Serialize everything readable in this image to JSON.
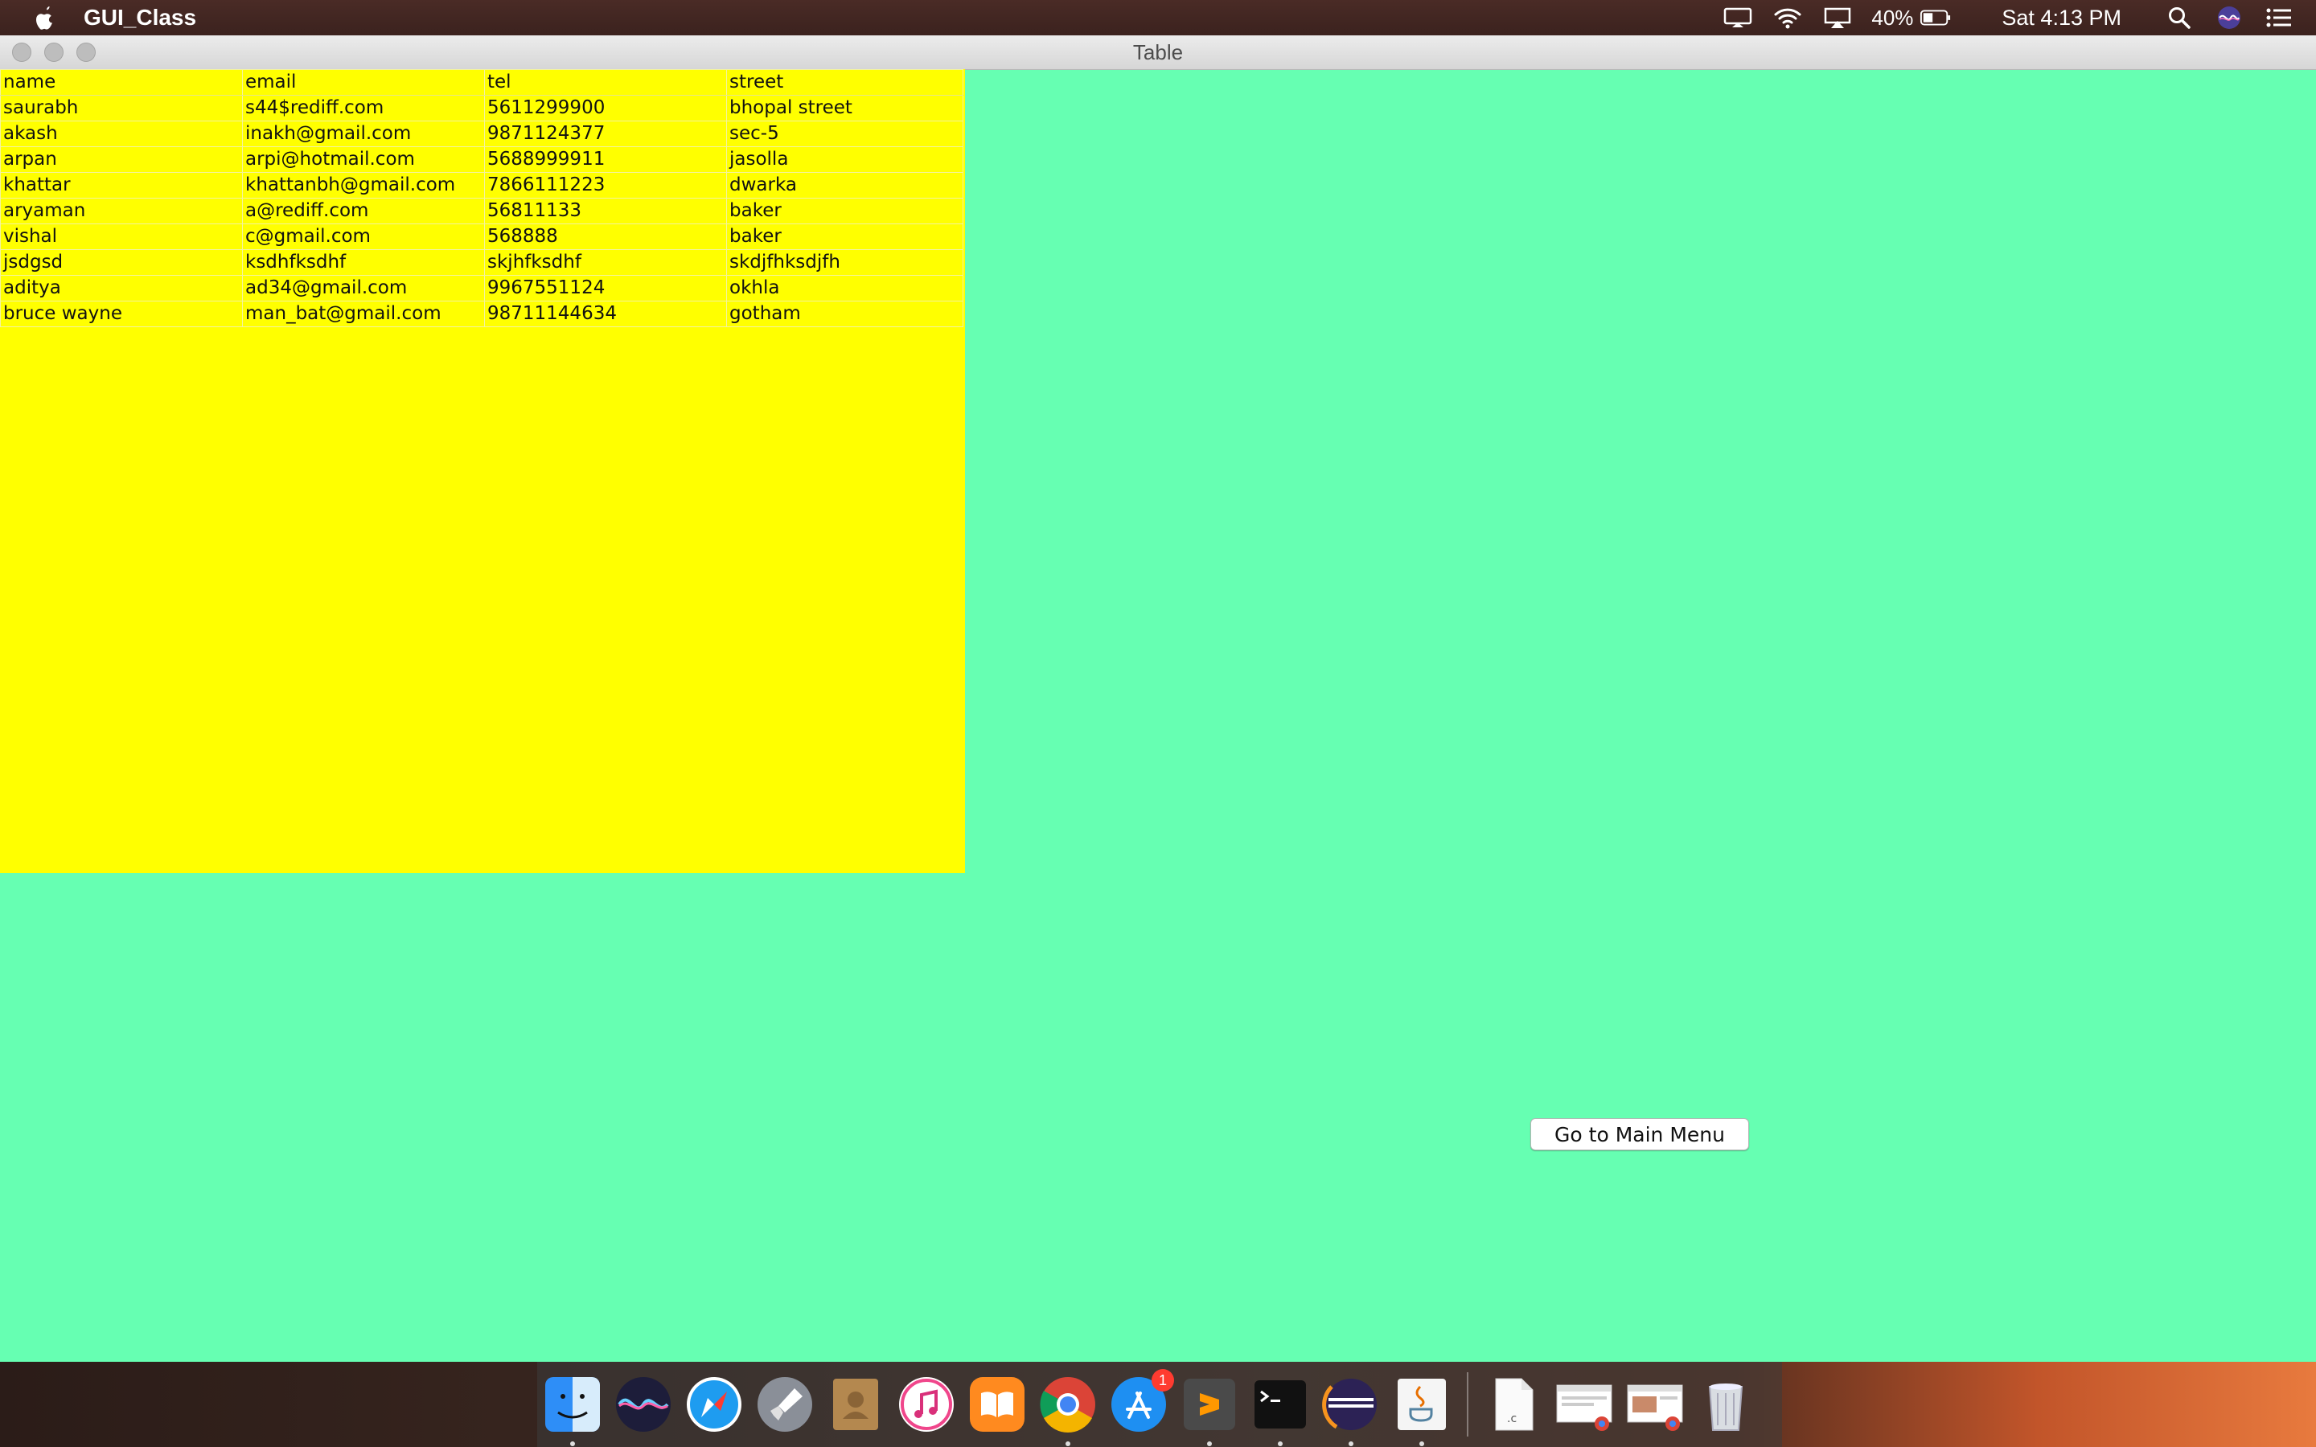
{
  "menubar": {
    "app_name": "GUI_Class",
    "battery_percent": "40%",
    "clock": "Sat 4:13 PM",
    "icons": [
      "apple-icon",
      "display-icon",
      "wifi-icon",
      "airplay-icon",
      "battery-icon",
      "spotlight-icon",
      "siri-icon",
      "notification-center-icon"
    ]
  },
  "window": {
    "title": "Table",
    "background_color": "#66ffb2",
    "table_background_color": "#ffff00"
  },
  "table": {
    "columns": [
      "name",
      "email",
      "tel",
      "street"
    ],
    "rows": [
      [
        "saurabh",
        "s44$rediff.com",
        "5611299900",
        "bhopal street"
      ],
      [
        "akash",
        "inakh@gmail.com",
        "9871124377",
        "sec-5"
      ],
      [
        "arpan",
        "arpi@hotmail.com",
        "5688999911",
        "jasolla"
      ],
      [
        "khattar",
        "khattanbh@gmail.com",
        "7866111223",
        "dwarka"
      ],
      [
        "aryaman",
        "a@rediff.com",
        "56811133",
        "baker"
      ],
      [
        "vishal",
        "c@gmail.com",
        "568888",
        "baker"
      ],
      [
        "jsdgsd",
        "ksdhfksdhf",
        "skjhfksdhf",
        "skdjfhksdjfh"
      ],
      [
        "aditya",
        "ad34@gmail.com",
        "9967551124",
        "okhla"
      ],
      [
        "bruce wayne",
        "man_bat@gmail.com",
        "98711144634",
        "gotham"
      ]
    ]
  },
  "button": {
    "main_menu_label": "Go to Main Menu"
  },
  "dock": {
    "items": [
      "finder-icon",
      "siri-icon",
      "safari-icon",
      "launchpad-icon",
      "contacts-icon",
      "itunes-icon",
      "ibooks-icon",
      "chrome-icon",
      "app-store-icon",
      "sublime-text-icon",
      "terminal-icon",
      "eclipse-icon",
      "java-icon",
      "document-icon",
      "chrome-window-icon",
      "chrome-window-icon-2",
      "trash-icon"
    ],
    "app_store_badge": "1"
  }
}
